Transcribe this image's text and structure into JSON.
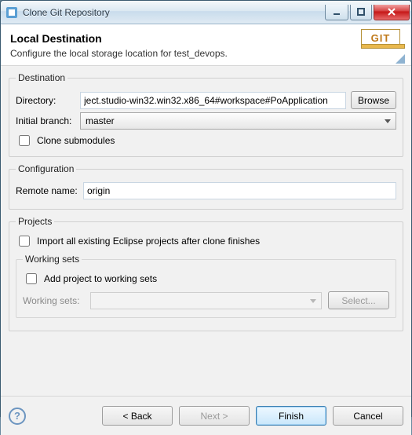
{
  "window": {
    "title": "Clone Git Repository"
  },
  "header": {
    "title": "Local Destination",
    "subtitle": "Configure the local storage location for test_devops.",
    "badge_text": "GIT"
  },
  "destination": {
    "legend": "Destination",
    "directory_label": "Directory:",
    "directory_value": "ject.studio-win32.win32.x86_64#workspace#PoApplication",
    "browse_label": "Browse",
    "initial_branch_label": "Initial branch:",
    "initial_branch_value": "master",
    "clone_submodules_label": "Clone submodules"
  },
  "configuration": {
    "legend": "Configuration",
    "remote_name_label": "Remote name:",
    "remote_name_value": "origin"
  },
  "projects": {
    "legend": "Projects",
    "import_label": "Import all existing Eclipse projects after clone finishes",
    "working_sets_legend": "Working sets",
    "add_to_ws_label": "Add project to working sets",
    "ws_label": "Working sets:",
    "select_label": "Select..."
  },
  "footer": {
    "back": "< Back",
    "next": "Next >",
    "finish": "Finish",
    "cancel": "Cancel"
  }
}
